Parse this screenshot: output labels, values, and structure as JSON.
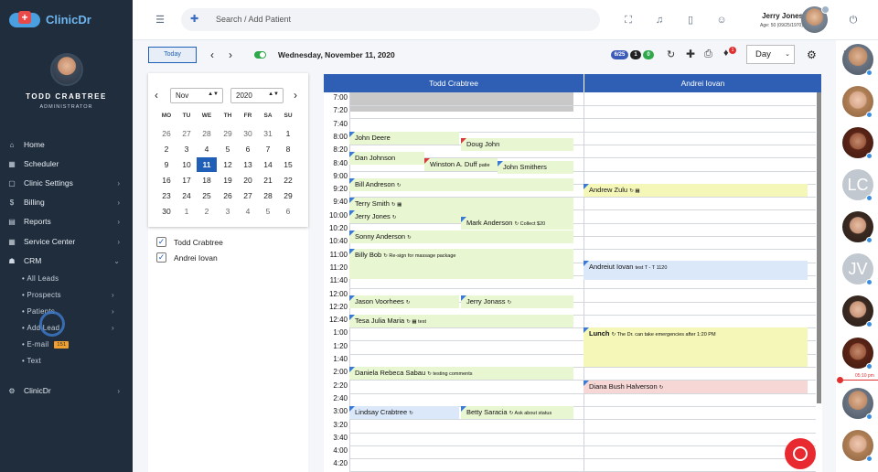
{
  "app": {
    "logo_text": "ClinicDr",
    "logo_cross": "+"
  },
  "profile": {
    "name": "TODD CRABTREE",
    "role": "ADMINISTRATOR"
  },
  "nav": {
    "items": [
      {
        "label": "Home",
        "icon": "home-icon",
        "glyph": "⌂"
      },
      {
        "label": "Scheduler",
        "icon": "calendar-icon",
        "glyph": "▦"
      },
      {
        "label": "Clinic Settings",
        "icon": "building-icon",
        "glyph": "▢"
      },
      {
        "label": "Billing",
        "icon": "dollar-icon",
        "glyph": "$"
      },
      {
        "label": "Reports",
        "icon": "chart-icon",
        "glyph": "▤"
      },
      {
        "label": "Service Center",
        "icon": "grid-icon",
        "glyph": "▦"
      },
      {
        "label": "CRM",
        "icon": "people-icon",
        "glyph": "☗"
      },
      {
        "label": "ClinicDr",
        "icon": "gear-icon",
        "glyph": "⚙"
      }
    ],
    "crm_sub": [
      "All Leads",
      "Prospects",
      "Patients",
      "Add Lead",
      "E-mail",
      "Text"
    ],
    "email_badge": "151",
    "chevron": "›",
    "chevron_down": "⌄",
    "bullet": "•"
  },
  "topbar": {
    "search_placeholder": "Search / Add Patient",
    "user_name": "Jerry Jones",
    "user_age": "Age: 50 (09/25/1970)",
    "icons": [
      "menu-icon",
      "add-user-icon",
      "fullscreen-icon",
      "bell-icon",
      "document-icon",
      "users-icon",
      "power-icon"
    ]
  },
  "toolbar": {
    "today_label": "Today",
    "prev": "‹",
    "next": "›",
    "date": "Wednesday, November 11, 2020",
    "pill_ratio": "6/25",
    "pill_count1": "1",
    "pill_count2": "0",
    "notif_badge": "1",
    "view": "Day",
    "select_arrow": "⌄"
  },
  "mini_calendar": {
    "month": "Nov",
    "year": "2020",
    "prev": "‹",
    "next": "›",
    "days_of_week": [
      "MO",
      "TU",
      "WE",
      "TH",
      "FR",
      "SA",
      "SU"
    ],
    "weeks": [
      [
        "26",
        "27",
        "28",
        "29",
        "30",
        "31",
        "1"
      ],
      [
        "2",
        "3",
        "4",
        "5",
        "6",
        "7",
        "8"
      ],
      [
        "9",
        "10",
        "11",
        "12",
        "13",
        "14",
        "15"
      ],
      [
        "16",
        "17",
        "18",
        "19",
        "20",
        "21",
        "22"
      ],
      [
        "23",
        "24",
        "25",
        "26",
        "27",
        "28",
        "29"
      ],
      [
        "30",
        "1",
        "2",
        "3",
        "4",
        "5",
        "6"
      ]
    ],
    "selected": "11"
  },
  "providers": [
    {
      "name": "Todd Crabtree",
      "checked": true
    },
    {
      "name": "Andrei Iovan",
      "checked": true
    }
  ],
  "check_glyph": "✓",
  "schedule": {
    "columns": [
      "Todd Crabtree",
      "Andrei Iovan"
    ],
    "times": [
      "7:00",
      "7:20",
      "7:40",
      "8:00",
      "8:20",
      "8:40",
      "9:00",
      "9:20",
      "9:40",
      "10:00",
      "10:20",
      "10:40",
      "11:00",
      "11:20",
      "11:40",
      "12:00",
      "12:20",
      "12:40",
      "1:00",
      "1:20",
      "1:40",
      "2:00",
      "2:20",
      "2:40",
      "3:00",
      "3:20",
      "3:40",
      "4:00",
      "4:20"
    ],
    "appointments": {
      "a1": {
        "name": "John Deere"
      },
      "a2": {
        "name": "Doug John"
      },
      "a3": {
        "name": "Dan Johnson"
      },
      "a4": {
        "name": "Winston A. Duff",
        "note": "patie"
      },
      "a5": {
        "name": "John Smithers"
      },
      "a6": {
        "name": "Bill Andreson",
        "note": "↻"
      },
      "a7": {
        "name": "Andrew Zulu",
        "note": "↻ ▦"
      },
      "a8": {
        "name": "Terry Smith",
        "note": "↻ ▦"
      },
      "a9": {
        "name": "Jerry Jones",
        "note": "↻"
      },
      "a10": {
        "name": "Mark Anderson",
        "note": "↻ Collect $20"
      },
      "a11": {
        "name": "Sonny Anderson",
        "note": "↻"
      },
      "a12": {
        "name": "Billy Bob",
        "note": "↻ Re-sign for massage package"
      },
      "a13": {
        "name": "Andreiut Iovan",
        "note": "test T - T 1120"
      },
      "a14": {
        "name": "Jason Voorhees",
        "note": "↻"
      },
      "a15": {
        "name": "Jerry Jonass",
        "note": "↻"
      },
      "a16": {
        "name": "Tesa Julia Maria",
        "note": "↻ ▦ test"
      },
      "a17": {
        "name": "Lunch",
        "note": "↻ The Dr. can take emergencies after 1:20 PM"
      },
      "a18": {
        "name": "Daniela Rebeca Sabau",
        "note": "↻ testing comments"
      },
      "a19": {
        "name": "Diana Bush Halverson",
        "note": "↻"
      },
      "a20": {
        "name": "Lindsay Crabtree",
        "note": "↻"
      },
      "a21": {
        "name": "Betty Saracia",
        "note": "↻ Ask about status"
      }
    }
  },
  "right_column": {
    "avatars": [
      "photo",
      "photo",
      "photo",
      "LC",
      "photo",
      "JV",
      "photo",
      "photo",
      "photo",
      "photo"
    ],
    "now_time": "05:10 pm"
  },
  "colors": {
    "sidebar": "#1f2d3d",
    "accent": "#2e5fb5",
    "green_appt": "#e9f6d2",
    "blue_appt": "#dbe8fa",
    "red_marker": "#e03030"
  }
}
